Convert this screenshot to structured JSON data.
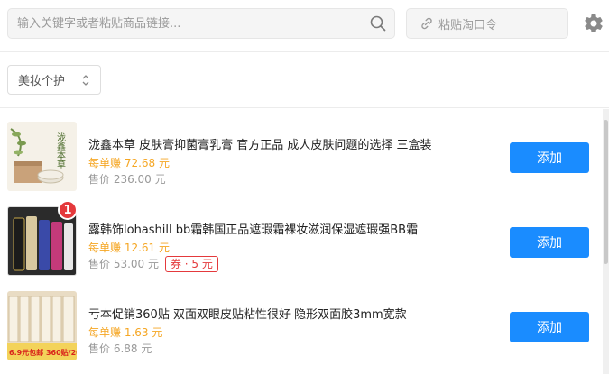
{
  "search": {
    "placeholder": "输入关键字或者粘贴商品链接..."
  },
  "paste": {
    "label": "粘贴淘口令"
  },
  "filter": {
    "category": "美妆个护"
  },
  "products": [
    {
      "title": "泷鑫本草 皮肤膏抑菌膏乳膏 官方正品 成人皮肤问题的选择 三盒装",
      "earn": "每单赚 72.68 元",
      "price": "售价 236.00 元",
      "coupon": "",
      "add_label": "添加",
      "thumb_text": "泷鑫本草"
    },
    {
      "title": "露韩饰lohashill bb霜韩国正品遮瑕霜裸妆滋润保湿遮瑕强BB霜",
      "earn": "每单赚 12.61 元",
      "price": "售价 53.00 元",
      "coupon": "券 · 5 元",
      "add_label": "添加",
      "badge": "1"
    },
    {
      "title": "亏本促销360贴 双面双眼皮贴粘性很好 隐形双面胶3mm宽款",
      "earn": "每单赚 1.63 元",
      "price": "售价 6.88 元",
      "coupon": "",
      "add_label": "添加",
      "thumb_text": "6.9元包邮 360贴/20张"
    }
  ],
  "colors": {
    "accent": "#1a8cff",
    "earn": "#f5a623",
    "coupon": "#e4393c"
  }
}
